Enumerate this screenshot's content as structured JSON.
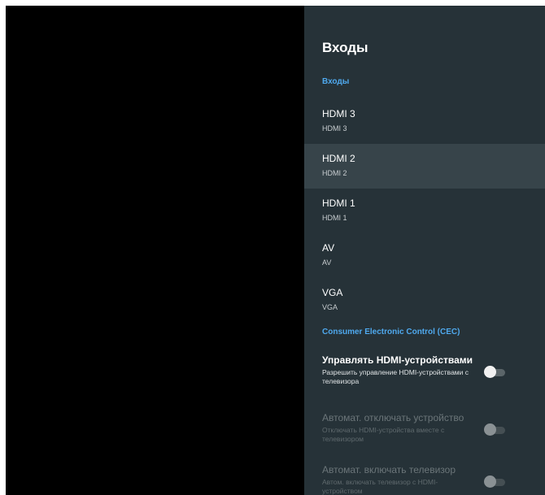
{
  "panel": {
    "title": "Входы",
    "inputs_header": "Входы",
    "inputs": [
      {
        "name": "HDMI 3",
        "subtitle": "HDMI 3",
        "focused": false
      },
      {
        "name": "HDMI 2",
        "subtitle": "HDMI 2",
        "focused": true
      },
      {
        "name": "HDMI 1",
        "subtitle": "HDMI 1",
        "focused": false
      },
      {
        "name": "AV",
        "subtitle": "AV",
        "focused": false
      },
      {
        "name": "VGA",
        "subtitle": "VGA",
        "focused": false
      }
    ],
    "cec_header": "Consumer Electronic Control (CEC)",
    "cec_options": [
      {
        "title": "Управлять HDMI-устройствами",
        "subtitle": "Разрешить управление HDMI-устройствами с телевизора",
        "enabled": true,
        "checked": false
      },
      {
        "title": "Автомат. отключать устройство",
        "subtitle": "Отключать HDMI-устройства вместе с телевизором",
        "enabled": false,
        "checked": false
      },
      {
        "title": "Автомат. включать телевизор",
        "subtitle": "Автом. включать телевизор с HDMI-устройством",
        "enabled": false,
        "checked": false
      }
    ]
  },
  "colors": {
    "panel_background": "#263238",
    "focused_row": "#37444a",
    "section_header": "#4fa9ee",
    "screen_background": "#000000"
  }
}
